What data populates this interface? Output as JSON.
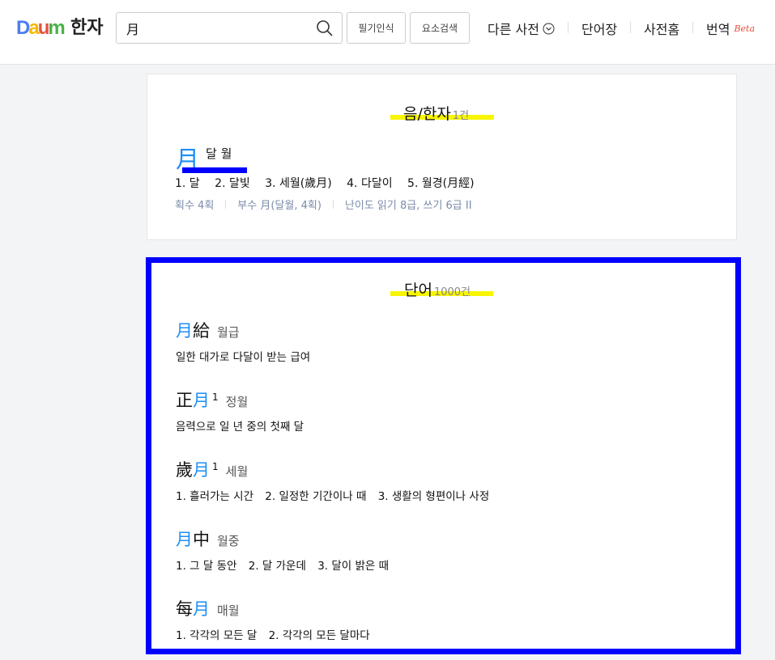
{
  "header": {
    "logo": [
      "D",
      "a",
      "u",
      "m"
    ],
    "title": "한자",
    "search": {
      "value": "月",
      "placeholder": ""
    },
    "handwrite_label": "필기인식",
    "element_search_label": "요소검색",
    "nav": {
      "other_dict": "다른 사전",
      "wordbook": "단어장",
      "dict_home": "사전홈",
      "translate": "번역",
      "beta": "Beta"
    }
  },
  "hanja_section": {
    "title": "음/한자",
    "count": "1건",
    "entry": {
      "char": "月",
      "reading": "달 월",
      "meanings": [
        "1. 달",
        "2. 달빛",
        "3. 세월(歲月)",
        "4. 다달이",
        "5. 월경(月經)"
      ],
      "meta": [
        "획수 4획",
        "부수 月(달월, 4획)",
        "난이도 읽기 8급, 쓰기 6급 II"
      ]
    }
  },
  "word_section": {
    "title": "단어",
    "count": "1000건",
    "words": [
      {
        "chars": [
          {
            "c": "月",
            "hit": true
          },
          {
            "c": "給",
            "hit": false
          }
        ],
        "sup": "",
        "reading": "월급",
        "defs": [
          "일한 대가로 다달이 받는 급여"
        ]
      },
      {
        "chars": [
          {
            "c": "正",
            "hit": false
          },
          {
            "c": "月",
            "hit": true
          }
        ],
        "sup": "1",
        "reading": "정월",
        "defs": [
          "음력으로 일 년 중의 첫째 달"
        ]
      },
      {
        "chars": [
          {
            "c": "歲",
            "hit": false
          },
          {
            "c": "月",
            "hit": true
          }
        ],
        "sup": "1",
        "reading": "세월",
        "defs": [
          "1. 흘러가는 시간",
          "2. 일정한 기간이나 때",
          "3. 생활의 형편이나 사정"
        ]
      },
      {
        "chars": [
          {
            "c": "月",
            "hit": true
          },
          {
            "c": "中",
            "hit": false
          }
        ],
        "sup": "",
        "reading": "월중",
        "defs": [
          "1. 그 달 동안",
          "2. 달 가운데",
          "3. 달이 밝은 때"
        ]
      },
      {
        "chars": [
          {
            "c": "每",
            "hit": false
          },
          {
            "c": "月",
            "hit": true
          }
        ],
        "sup": "",
        "reading": "매월",
        "defs": [
          "1. 각각의 모든 달",
          "2. 각각의 모든 달마다"
        ]
      }
    ]
  },
  "colors": {
    "accent_blue": "#1d8ef5",
    "highlight_yellow": "#f7f500",
    "annotation_blue": "#0000ff"
  }
}
